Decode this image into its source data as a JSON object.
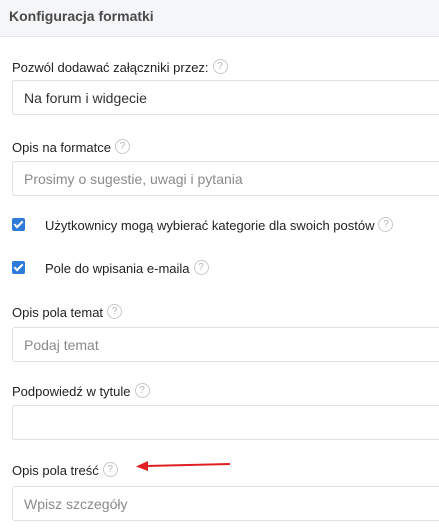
{
  "header": {
    "title": "Konfiguracja formatki"
  },
  "help_symbol": "?",
  "fields": {
    "attachments": {
      "label": "Pozwól dodawać załączniki przez:",
      "value": "Na forum i widgecie"
    },
    "form_description": {
      "label": "Opis na formatce",
      "placeholder": "Prosimy o sugestie, uwagi i pytania"
    },
    "subject_description": {
      "label": "Opis pola temat",
      "placeholder": "Podaj temat"
    },
    "title_hint": {
      "label": "Podpowiedź w tytule",
      "placeholder": ""
    },
    "body_description": {
      "label": "Opis pola treść",
      "placeholder": "Wpisz szczegóły"
    }
  },
  "checkboxes": {
    "categories": {
      "label": "Użytkownicy mogą wybierać kategorie dla swoich postów",
      "checked": true
    },
    "email": {
      "label": "Pole do wpisania e-maila",
      "checked": true
    }
  },
  "colors": {
    "accent": "#2d7ad8",
    "annotation_arrow": "#e02020"
  }
}
